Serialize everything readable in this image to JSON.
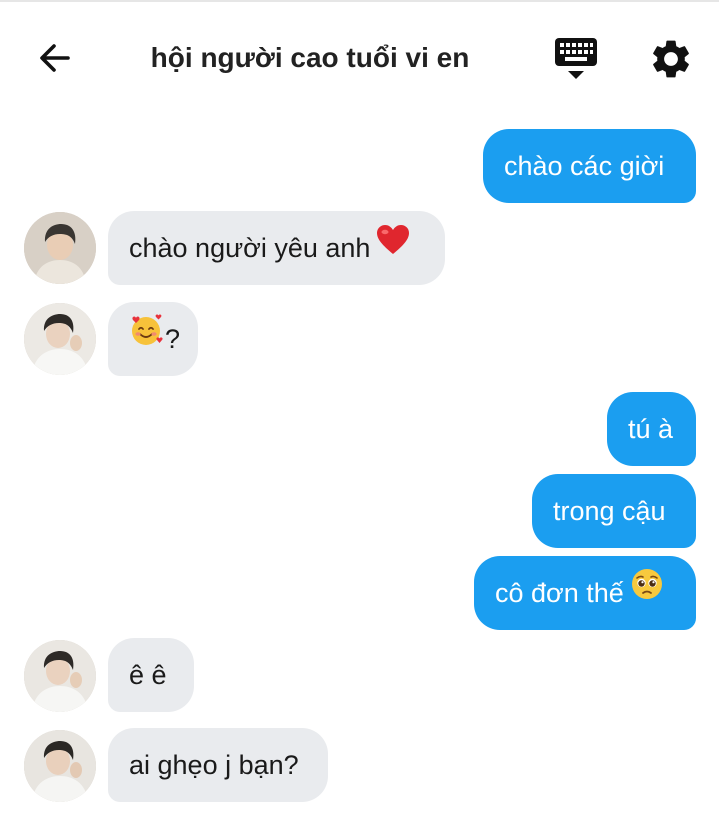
{
  "header": {
    "title": "hội người cao tuổi vi en",
    "back_icon": "arrow-left-icon",
    "keyboard_icon": "keyboard-icon",
    "settings_icon": "gear-icon"
  },
  "colors": {
    "sent_bubble": "#1b9ef0",
    "received_bubble": "#e9ebee",
    "background": "#ffffff"
  },
  "messages": [
    {
      "side": "sent",
      "text": "chào các giời"
    },
    {
      "side": "received",
      "text": "chào người yêu anh",
      "emoji": "red-heart-icon"
    },
    {
      "side": "received",
      "text": "?",
      "emoji": "smiling-face-with-hearts-icon"
    },
    {
      "side": "sent",
      "text": "tú à"
    },
    {
      "side": "sent",
      "text": "trong cậu"
    },
    {
      "side": "sent",
      "text": "cô đơn thế",
      "emoji": "pleading-face-icon"
    },
    {
      "side": "received",
      "text": "ê ê"
    },
    {
      "side": "received",
      "text": "ai ghẹo j bạn?"
    }
  ]
}
